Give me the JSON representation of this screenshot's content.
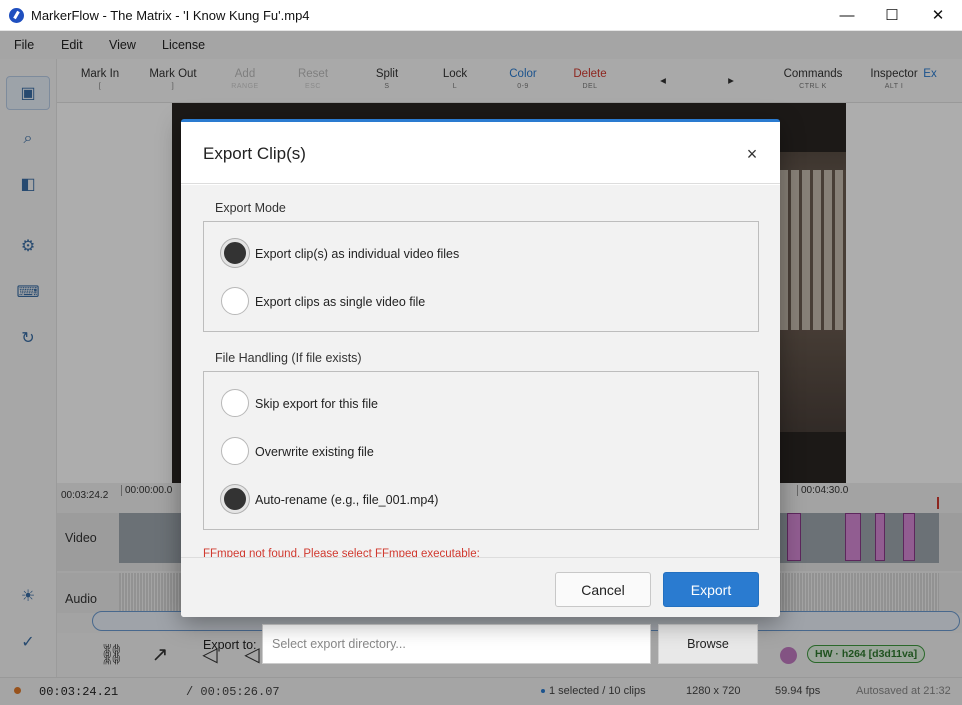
{
  "window": {
    "title": "MarkerFlow - The Matrix - 'I Know Kung Fu'.mp4",
    "minimize": "—",
    "maximize": "☐",
    "close": "✕"
  },
  "menu": [
    "File",
    "Edit",
    "View",
    "License"
  ],
  "sidebar": {
    "icons": [
      "select-icon",
      "search-icon",
      "panel-icon",
      "settings-icon",
      "keyboard-icon",
      "refresh-icon",
      "brightness-icon",
      "check-icon"
    ]
  },
  "toolbar": {
    "tools": [
      {
        "label": "Mark In",
        "key": "["
      },
      {
        "label": "Mark Out",
        "key": "]"
      },
      {
        "label": "Add",
        "key": "RANGE"
      },
      {
        "label": "Reset",
        "key": "ESC"
      },
      {
        "label": "Split",
        "key": "S"
      },
      {
        "label": "Lock",
        "key": "L"
      },
      {
        "label": "Color",
        "key": "0-9"
      },
      {
        "label": "Delete",
        "key": "DEL"
      },
      {
        "label": "◂",
        "key": ""
      },
      {
        "label": "▸",
        "key": ""
      },
      {
        "label": "Commands",
        "key": "CTRL K"
      },
      {
        "label": "Inspector",
        "key": "ALT I"
      },
      {
        "label": "Ex",
        "key": ""
      }
    ]
  },
  "timeline": {
    "current_tc": "00:03:24.2",
    "start_tc": "00:00:00.0",
    "right_tc": "00:04:30.0",
    "video_label": "Video",
    "audio_label": "Audio"
  },
  "status": {
    "time": "00:03:24.21",
    "duration": "/ 00:05:26.07",
    "selection": "1 selected / 10 clips",
    "resolution": "1280 x 720",
    "fps": "59.94 fps",
    "autosave": "Autosaved at 21:32",
    "hw_badge": "HW · h264 [d3d11va]"
  },
  "dialog": {
    "title": "Export Clip(s)",
    "close": "×",
    "export_mode": {
      "label": "Export Mode",
      "options": [
        {
          "label": "Export clip(s) as individual video files",
          "checked": true
        },
        {
          "label": "Export clips as single video file",
          "checked": false
        }
      ]
    },
    "file_handling": {
      "label": "File Handling (If file exists)",
      "options": [
        {
          "label": "Skip export for this file",
          "checked": false
        },
        {
          "label": "Overwrite existing file",
          "checked": false
        },
        {
          "label": "Auto-rename (e.g., file_001.mp4)",
          "checked": true
        }
      ]
    },
    "error": "FFmpeg not found. Please select FFmpeg executable:",
    "cancel": "Cancel",
    "export": "Export"
  },
  "export_to": {
    "label": "Export to:",
    "placeholder": "Select export directory...",
    "browse": "Browse"
  },
  "colors": {
    "accent": "#2a7bd0",
    "delete": "#d0392f",
    "marker": "#d68ad6"
  }
}
